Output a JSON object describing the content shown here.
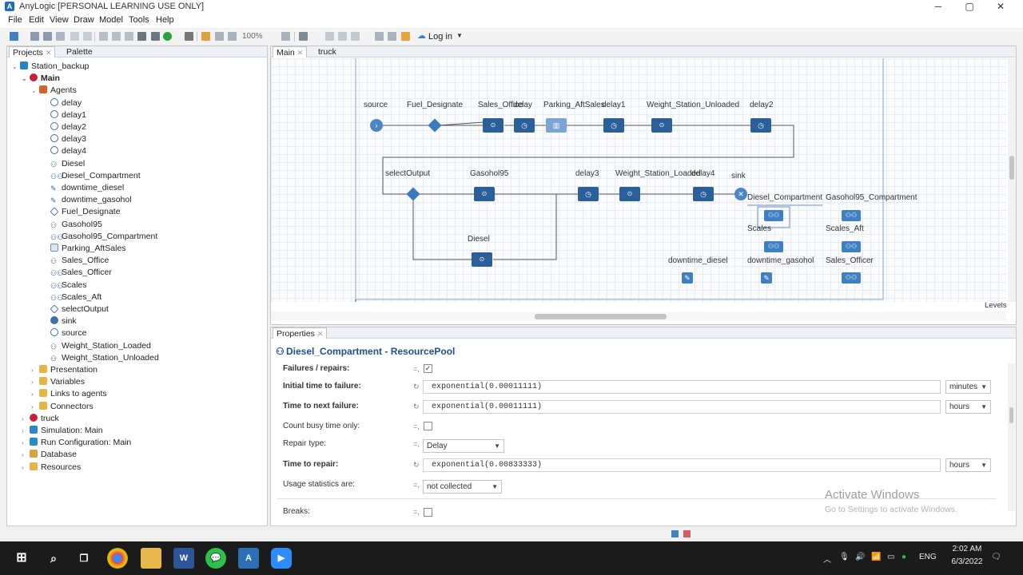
{
  "window": {
    "title": "AnyLogic [PERSONAL LEARNING USE ONLY]",
    "app_icon": "A",
    "minimize": "─",
    "maximize": "▢",
    "close": "✕"
  },
  "menu": [
    "File",
    "Edit",
    "View",
    "Draw",
    "Model",
    "Tools",
    "Help"
  ],
  "toolbar": {
    "zoom": "100%",
    "login": "Log in"
  },
  "left_tabs": [
    "Projects",
    "Palette"
  ],
  "tree": {
    "root": "Station_backup",
    "main": "Main",
    "agents_folder": "Agents",
    "agents": [
      "delay",
      "delay1",
      "delay2",
      "delay3",
      "delay4",
      "Diesel",
      "Diesel_Compartment",
      "downtime_diesel",
      "downtime_gasohol",
      "Fuel_Designate",
      "Gasohol95",
      "Gasohol95_Compartment",
      "Parking_AftSales",
      "Sales_Office",
      "Sales_Officer",
      "Scales",
      "Scales_Aft",
      "selectOutput",
      "sink",
      "source",
      "Weight_Station_Loaded",
      "Weight_Station_Unloaded"
    ],
    "agent_icons": [
      "delay",
      "delay",
      "delay",
      "delay",
      "delay",
      "svc",
      "res",
      "wrench",
      "wrench",
      "diamond",
      "svc",
      "res",
      "grid",
      "svc",
      "res",
      "res",
      "res",
      "diamond",
      "sink",
      "src",
      "svc",
      "svc"
    ],
    "main_children": [
      "Presentation",
      "Variables",
      "Links to agents",
      "Connectors"
    ],
    "other": [
      "truck",
      "Simulation: Main",
      "Run Configuration: Main",
      "Database",
      "Resources"
    ]
  },
  "editor_tabs": [
    "Main",
    "truck"
  ],
  "canvas": {
    "labels": {
      "source": "source",
      "fuel": "Fuel_Designate",
      "sales_office": "Sales_Office",
      "delay": "delay",
      "parking": "Parking_AftSales",
      "delay1": "delay1",
      "wsu": "Weight_Station_Unloaded",
      "delay2": "delay2",
      "select": "selectOutput",
      "gasohol": "Gasohol95",
      "delay3": "delay3",
      "wsl": "Weight_Station_Loaded",
      "delay4": "delay4",
      "sink": "sink",
      "diesel_comp": "Diesel_Compartment",
      "gas_comp": "Gasohol95_Compartment",
      "scales": "Scales",
      "scales_aft": "Scales_Aft",
      "diesel": "Diesel",
      "dt_diesel": "downtime_diesel",
      "dt_gasohol": "downtime_gasohol",
      "sales_officer": "Sales_Officer"
    },
    "levels": "Levels"
  },
  "properties": {
    "tab": "Properties",
    "header": "Diesel_Compartment - ResourcePool",
    "rows": {
      "failures": "Failures / repairs:",
      "initial": "Initial time to failure:",
      "initial_val": "exponential(0.00011111)",
      "initial_unit": "minutes",
      "next": "Time to next failure:",
      "next_val": "exponential(0.00011111)",
      "next_unit": "hours",
      "busy": "Count busy time only:",
      "repair_type": "Repair type:",
      "repair_type_val": "Delay",
      "repair": "Time to repair:",
      "repair_val": "exponential(0.00833333)",
      "repair_unit": "hours",
      "usage": "Usage statistics are:",
      "usage_val": "not collected",
      "breaks": "Breaks:"
    }
  },
  "watermark": {
    "line1": "Activate Windows",
    "line2": "Go to Settings to activate Windows."
  },
  "taskbar": {
    "time": "2:02 AM",
    "date": "6/3/2022",
    "lang": "ENG"
  }
}
